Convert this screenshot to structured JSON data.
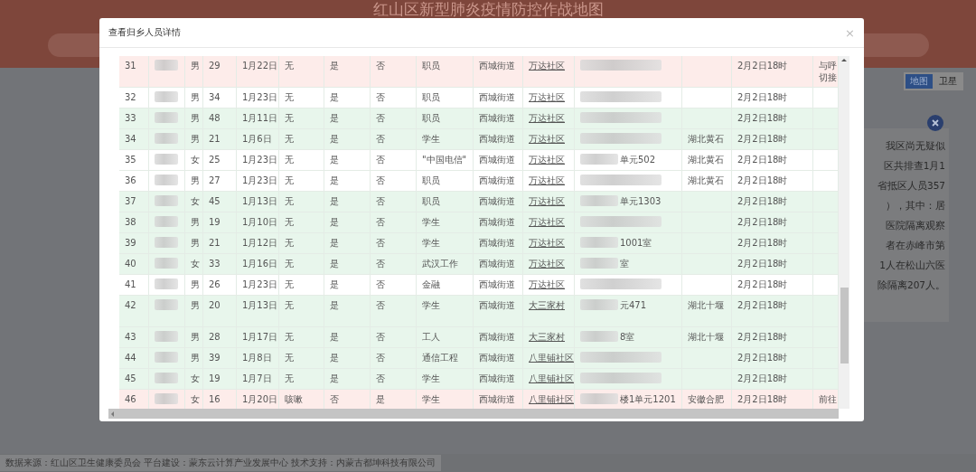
{
  "header": {
    "title": "红山区新型肺炎疫情防控作战地图"
  },
  "map_toggle": [
    {
      "label": "地图",
      "selected": true
    },
    {
      "label": "卫星",
      "selected": false
    }
  ],
  "info_panel": {
    "lines": [
      "我区尚无疑似",
      "区共排查1月1",
      "省抵区人员357",
      "），其中：居",
      "医院隔离观察",
      "者在赤峰市第",
      "1人在松山六医",
      "除隔离207人。"
    ]
  },
  "dialog": {
    "title": "查看归乡人员详情",
    "close": "×",
    "rows": [
      {
        "color": "#fdecea",
        "tall": true,
        "column_1": "31",
        "column_3": "男",
        "column_4": "29",
        "column_5": "1月22日",
        "column_6": "无",
        "column_7": "是",
        "column_8": "否",
        "column_9": "职员",
        "column_10": "西城街道",
        "column_11": "万达社区",
        "column_14": "2月2日18时",
        "column_15": "与呼切接"
      },
      {
        "color": "#ffffff",
        "tall": false,
        "column_1": "32",
        "column_3": "男",
        "column_4": "34",
        "column_5": "1月23日",
        "column_6": "无",
        "column_7": "是",
        "column_8": "否",
        "column_9": "职员",
        "column_10": "西城街道",
        "column_11": "万达社区",
        "column_14": "2月2日18时"
      },
      {
        "color": "#e8f6ec",
        "tall": false,
        "column_1": "33",
        "column_3": "男",
        "column_4": "48",
        "column_5": "1月11日",
        "column_6": "无",
        "column_7": "是",
        "column_8": "否",
        "column_9": "职员",
        "column_10": "西城街道",
        "column_11": "万达社区",
        "column_14": "2月2日18时"
      },
      {
        "color": "#e8f6ec",
        "tall": false,
        "column_1": "34",
        "column_3": "男",
        "column_4": "21",
        "column_5": "1月6日",
        "column_6": "无",
        "column_7": "是",
        "column_8": "否",
        "column_9": "学生",
        "column_10": "西城街道",
        "column_11": "万达社区",
        "column_13": "湖北黄石",
        "column_14": "2月2日18时"
      },
      {
        "color": "#ffffff",
        "tall": false,
        "column_1": "35",
        "column_3": "女",
        "column_4": "25",
        "column_5": "1月23日",
        "column_6": "无",
        "column_7": "是",
        "column_8": "否",
        "column_9": "\"中国电信\"",
        "column_10": "西城街道",
        "column_11": "万达社区",
        "column_12": "单元502",
        "column_13": "湖北黄石",
        "column_14": "2月2日18时"
      },
      {
        "color": "#ffffff",
        "tall": false,
        "column_1": "36",
        "column_3": "男",
        "column_4": "27",
        "column_5": "1月23日",
        "column_6": "无",
        "column_7": "是",
        "column_8": "否",
        "column_9": "职员",
        "column_10": "西城街道",
        "column_11": "万达社区",
        "column_13": "湖北黄石",
        "column_14": "2月2日18时"
      },
      {
        "color": "#e8f6ec",
        "tall": false,
        "column_1": "37",
        "column_3": "女",
        "column_4": "45",
        "column_5": "1月13日",
        "column_6": "无",
        "column_7": "是",
        "column_8": "否",
        "column_9": "职员",
        "column_10": "西城街道",
        "column_11": "万达社区",
        "column_12": "单元1303",
        "column_14": "2月2日18时"
      },
      {
        "color": "#e8f6ec",
        "tall": false,
        "column_1": "38",
        "column_3": "男",
        "column_4": "19",
        "column_5": "1月10日",
        "column_6": "无",
        "column_7": "是",
        "column_8": "否",
        "column_9": "学生",
        "column_10": "西城街道",
        "column_11": "万达社区",
        "column_14": "2月2日18时"
      },
      {
        "color": "#e8f6ec",
        "tall": false,
        "column_1": "39",
        "column_3": "男",
        "column_4": "21",
        "column_5": "1月12日",
        "column_6": "无",
        "column_7": "是",
        "column_8": "否",
        "column_9": "学生",
        "column_10": "西城街道",
        "column_11": "万达社区",
        "column_12": "1001室",
        "column_14": "2月2日18时"
      },
      {
        "color": "#e8f6ec",
        "tall": false,
        "column_1": "40",
        "column_3": "女",
        "column_4": "33",
        "column_5": "1月16日",
        "column_6": "无",
        "column_7": "是",
        "column_8": "否",
        "column_9": "武汉工作",
        "column_10": "西城街道",
        "column_11": "万达社区",
        "column_12": "室",
        "column_14": "2月2日18时"
      },
      {
        "color": "#ffffff",
        "tall": false,
        "column_1": "41",
        "column_3": "男",
        "column_4": "26",
        "column_5": "1月23日",
        "column_6": "无",
        "column_7": "是",
        "column_8": "否",
        "column_9": "金融",
        "column_10": "西城街道",
        "column_11": "万达社区",
        "column_14": "2月2日18时"
      },
      {
        "color": "#e8f6ec",
        "tall": true,
        "column_1": "42",
        "column_3": "男",
        "column_4": "20",
        "column_5": "1月13日",
        "column_6": "无",
        "column_7": "是",
        "column_8": "否",
        "column_9": "学生",
        "column_10": "西城街道",
        "column_11": "大三家村",
        "column_12": "元471",
        "column_13": "湖北十堰",
        "column_14": "2月2日18时"
      },
      {
        "color": "#e8f6ec",
        "tall": false,
        "column_1": "43",
        "column_3": "男",
        "column_4": "28",
        "column_5": "1月17日",
        "column_6": "无",
        "column_7": "是",
        "column_8": "否",
        "column_9": "工人",
        "column_10": "西城街道",
        "column_11": "大三家村",
        "column_12": "8室",
        "column_13": "湖北十堰",
        "column_14": "2月2日18时"
      },
      {
        "color": "#e8f6ec",
        "tall": false,
        "column_1": "44",
        "column_3": "男",
        "column_4": "39",
        "column_5": "1月8日",
        "column_6": "无",
        "column_7": "是",
        "column_8": "否",
        "column_9": "通信工程",
        "column_10": "西城街道",
        "column_11": "八里铺社区",
        "column_14": "2月2日18时"
      },
      {
        "color": "#e8f6ec",
        "tall": false,
        "column_1": "45",
        "column_3": "女",
        "column_4": "19",
        "column_5": "1月7日",
        "column_6": "无",
        "column_7": "是",
        "column_8": "否",
        "column_9": "学生",
        "column_10": "西城街道",
        "column_11": "八里铺社区",
        "column_14": "2月2日18时"
      },
      {
        "color": "#fdecea",
        "tall": false,
        "column_1": "46",
        "column_3": "女",
        "column_4": "16",
        "column_5": "1月20日",
        "column_6": "咳嗽",
        "column_7": "否",
        "column_8": "是",
        "column_9": "学生",
        "column_10": "西城街道",
        "column_11": "八里铺社区",
        "column_12": "楼1单元1201",
        "column_13": "安徽合肥",
        "column_14": "2月2日18时",
        "column_15": "前往"
      }
    ]
  },
  "footer": {
    "text": "数据来源：红山区卫生健康委员会 平台建设：蒙东云计算产业发展中心 技术支持：内蒙古都坤科技有限公司"
  }
}
